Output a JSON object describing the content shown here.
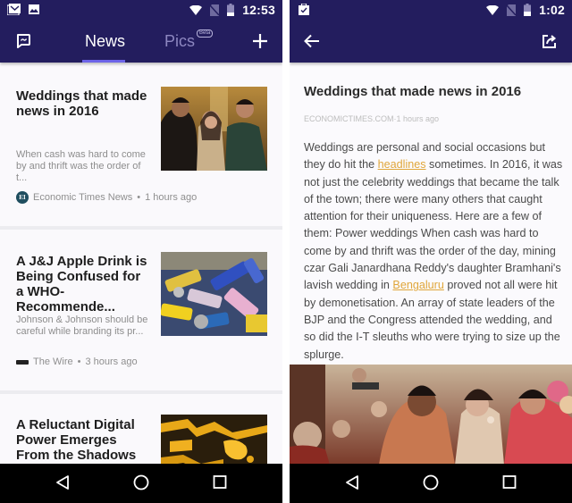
{
  "left_screen": {
    "status_bar": {
      "notification_icons": [
        "gmail-icon",
        "image-icon"
      ],
      "system_icons": [
        "wifi-icon",
        "no-sim-icon",
        "battery-icon"
      ],
      "time": "12:53"
    },
    "toolbar": {
      "feedback_icon": "chat-feedback-icon",
      "tabs": [
        {
          "label": "News",
          "active": true
        },
        {
          "label": "Pics",
          "active": false,
          "badge": "Beta"
        }
      ],
      "add_icon": "plus-icon"
    },
    "feed": [
      {
        "title": "Weddings that made news in 2016",
        "excerpt": "When cash was hard to come by and thrift was the order of t...",
        "source_logo": "EI",
        "source": "Economic Times News",
        "time": "1 hours ago",
        "separator": "•"
      },
      {
        "title": "A J&J Apple Drink is Being Confused for a WHO-Recommende...",
        "excerpt": "Johnson & Johnson should be careful while branding its pr...",
        "source_logo": "Wire",
        "source": "The Wire",
        "time": "3 hours ago",
        "separator": "•"
      },
      {
        "title": "A Reluctant Digital Power Emerges From the Shadows",
        "excerpt": "",
        "source": "",
        "time": ""
      }
    ]
  },
  "right_screen": {
    "status_bar": {
      "notification_icons": [
        "clipboard-check-icon"
      ],
      "system_icons": [
        "wifi-icon",
        "no-sim-icon",
        "battery-icon"
      ],
      "time": "1:02"
    },
    "toolbar": {
      "back_icon": "arrow-back-icon",
      "share_icon": "share-icon"
    },
    "article": {
      "title": "Weddings that made news in 2016",
      "meta": "ECONOMICTIMES.COM·1 hours ago",
      "body_parts": [
        {
          "text": "Weddings are personal and social occasions but they do hit the ",
          "link": false
        },
        {
          "text": "headlines",
          "link": true
        },
        {
          "text": " sometimes. In 2016, it was not just the celebrity weddings that became the talk of the town; there were many others that caught attention for their uniqueness. Here are a few of them: Power weddings When cash was hard to come by and thrift was the order of the day, mining czar Gali Janardhana Reddy's daughter Bramhani's lavish wedding in ",
          "link": false
        },
        {
          "text": "Bengaluru",
          "link": true
        },
        {
          "text": " proved not all were hit by demonetisation. An array of state leaders of the BJP and the Congress attended the wedding, and so did the I-T sleuths who were trying to size up the splurge.",
          "link": false
        }
      ]
    }
  },
  "nav_bar": {
    "buttons": [
      "back-triangle-icon",
      "home-circle-icon",
      "recents-square-icon"
    ]
  },
  "colors": {
    "appbar": "#231d5e",
    "tab_active": "#ffffff",
    "tab_inactive": "#8d87c0",
    "tab_indicator": "#6d64e8",
    "link": "#e0a63a"
  }
}
